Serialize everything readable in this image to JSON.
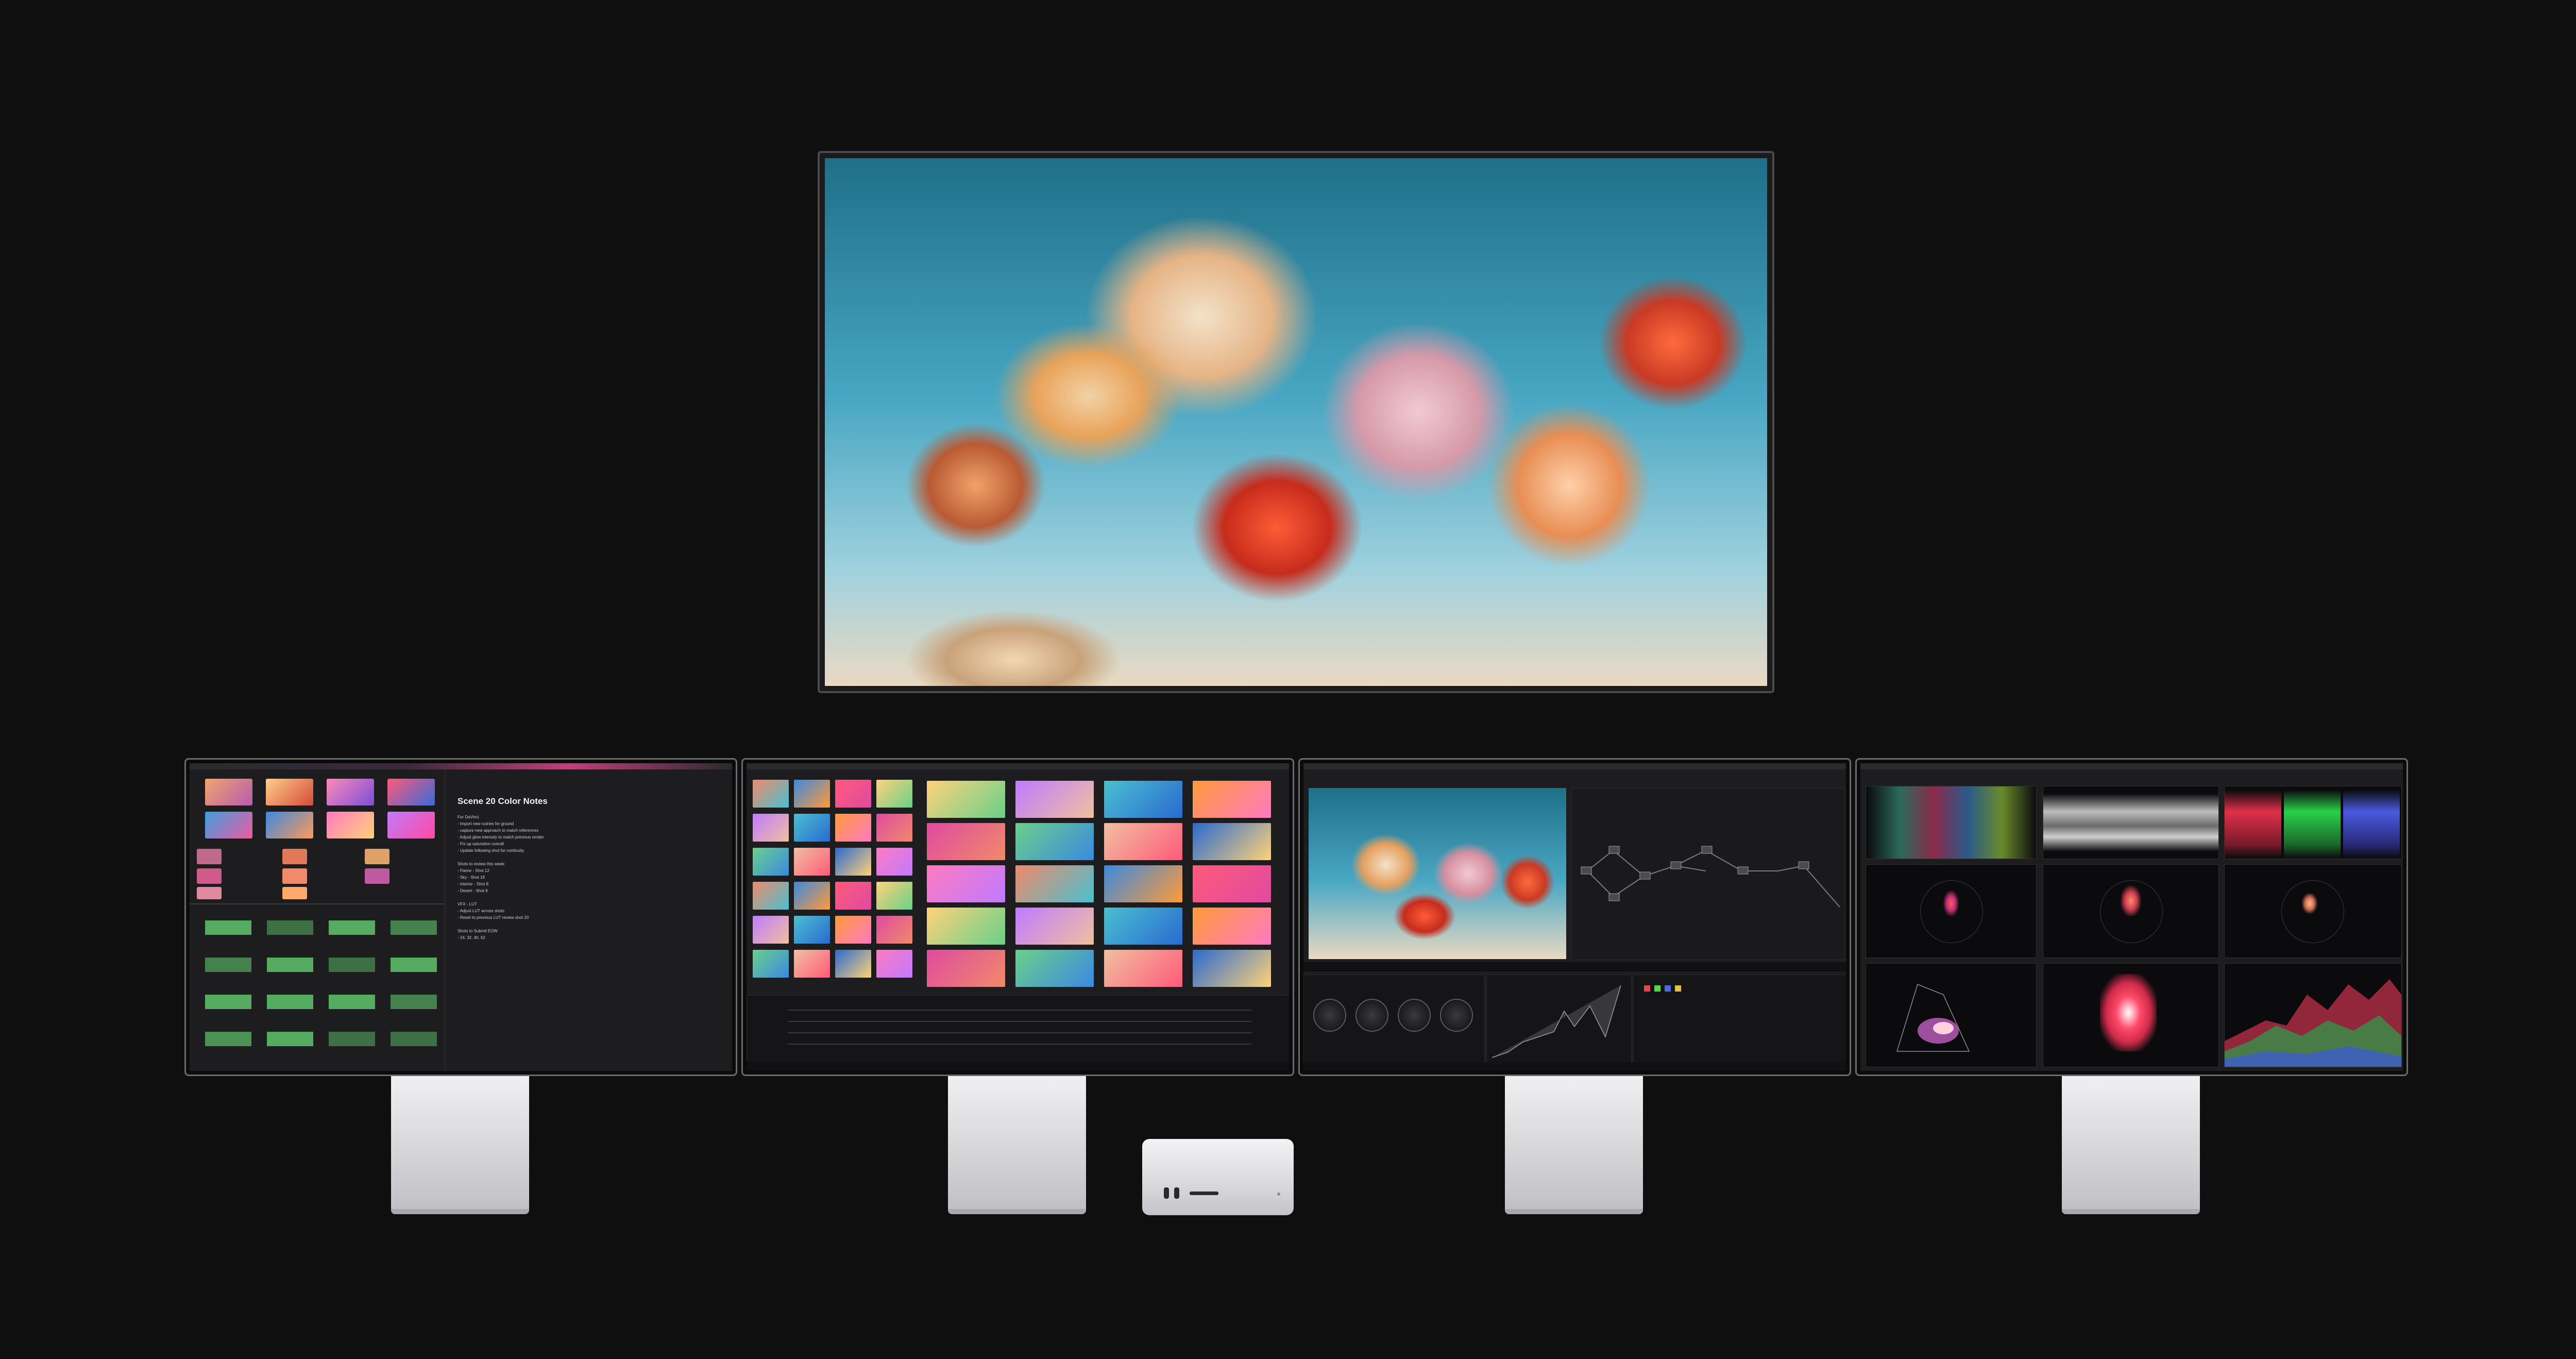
{
  "scene": {
    "background": "#0f0f10",
    "devices": [
      "tv-display",
      "monitor-1",
      "monitor-2",
      "monitor-3",
      "monitor-4",
      "mac-studio"
    ]
  },
  "monitor1": {
    "notes_title": "Scene 20 Color Notes",
    "notes": [
      "For DaVinci",
      "- Import new rushes for ground",
      "- capture new approach to match references",
      "- Adjust glow intensity to match previous render",
      "- Fix up saturation overall",
      "- Update following shot for continuity",
      "",
      "Shots to review this week:",
      "- Flame - Shot 12",
      "- Sky - Shot 18",
      "- Interior - Shot 8",
      "- Desert - Shot 6",
      "",
      "VFX - LUT",
      "- Adjust LUT across shots",
      "- Reset to previous LUT review shot 20",
      "",
      "Shots to Submit EOW",
      "- 24, 32, 40, 62"
    ]
  },
  "colors": {
    "accent_green": "#5fc46a",
    "bezel": "#6a6a6d",
    "stand": "#d6d6d9"
  }
}
